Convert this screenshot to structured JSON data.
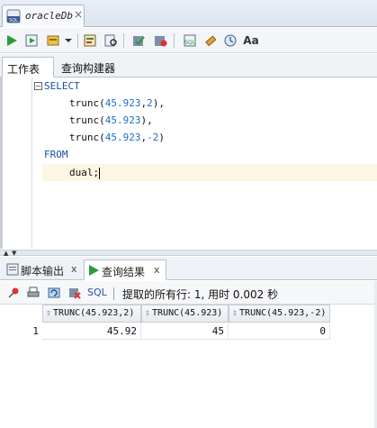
{
  "document_tab": {
    "title": "oracleDb",
    "close": "×",
    "icon": "sql-file-icon"
  },
  "toolbar": {
    "buttons": [
      "run-statement-icon",
      "run-script-icon",
      "autotrace-icon",
      "dropdown-arrow-icon",
      "explain-plan-icon",
      "sql-tuning-icon",
      "commit-icon",
      "rollback-icon",
      "unshared-sql-icon",
      "clear-icon",
      "sql-history-icon",
      "change-case-icon"
    ],
    "change_case_label": "Aa"
  },
  "subtabs": {
    "worksheet": "工作表",
    "query_builder": "查询构建器"
  },
  "editor": {
    "fold_marker": "−",
    "lines": [
      {
        "kind": "kw",
        "text": "SELECT"
      },
      {
        "kind": "fn",
        "fn": "trunc(",
        "num1": "45.923",
        "sep": ",",
        "num2": "2",
        "close": "),"
      },
      {
        "kind": "fn1",
        "fn": "trunc(",
        "num1": "45.923",
        "close": "),"
      },
      {
        "kind": "fn",
        "fn": "trunc(",
        "num1": "45.923",
        "sep": ",",
        "num2": "-2",
        "close": ")"
      },
      {
        "kind": "kw",
        "text": "FROM"
      },
      {
        "kind": "plain",
        "text": "dual;"
      }
    ]
  },
  "bottom_tabs": {
    "script_output": "脚本输出",
    "query_result": "查询结果",
    "close": "x"
  },
  "result_toolbar": {
    "sql_label": "SQL",
    "status": "提取的所有行: 1, 用时 0.002 秒"
  },
  "grid": {
    "columns": [
      "TRUNC(45.923,2)",
      "TRUNC(45.923)",
      "TRUNC(45.923,-2)"
    ],
    "rows": [
      {
        "num": "1",
        "cells": [
          "45.92",
          "45",
          "0"
        ]
      }
    ]
  },
  "colors": {
    "keyword": "#1b4ea8",
    "number": "#1f6dc7",
    "current_line": "#fdf6e3"
  }
}
